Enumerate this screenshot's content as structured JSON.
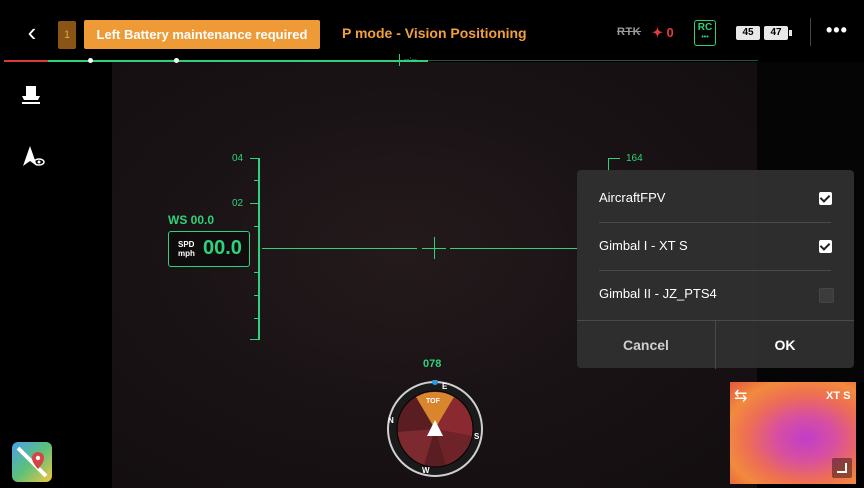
{
  "topbar": {
    "back_icon": "chevron-left-icon",
    "warning_count": "1",
    "warning_banner": "Left Battery maintenance required",
    "flight_mode": "P mode - Vision Positioning",
    "rtk_label": "RTK",
    "satellite_count": "0",
    "rc_label": "RC",
    "battery_left": "45",
    "battery_right": "47",
    "more_icon": "more-horizontal-icon"
  },
  "sidebar": {
    "icons": [
      "landing-icon",
      "map-marker-eye-icon"
    ]
  },
  "hud": {
    "altitude_ticks": [
      "04",
      "02"
    ],
    "ws_label": "WS 00.0",
    "speed_unit_top": "SPD",
    "speed_unit_bottom": "mph",
    "speed_value": "00.0",
    "right_tick": "164",
    "heading": "078",
    "compass_tof": "TOF",
    "compass_letters": [
      "E",
      "S",
      "W",
      "N"
    ]
  },
  "dialog": {
    "options": [
      {
        "label": "AircraftFPV",
        "checked": true
      },
      {
        "label": "Gimbal I - XT S",
        "checked": true
      },
      {
        "label": "Gimbal II - JZ_PTS4",
        "checked": false
      }
    ],
    "cancel_label": "Cancel",
    "ok_label": "OK"
  },
  "thermal": {
    "label": "XT S",
    "swap_icon": "swap-icon",
    "expand_icon": "expand-corner-icon"
  },
  "map_icon": "maps-app-icon",
  "colors": {
    "hud_green": "#2ed27a",
    "warning_orange": "#ee9a36",
    "mode_orange": "#f29f3c"
  }
}
